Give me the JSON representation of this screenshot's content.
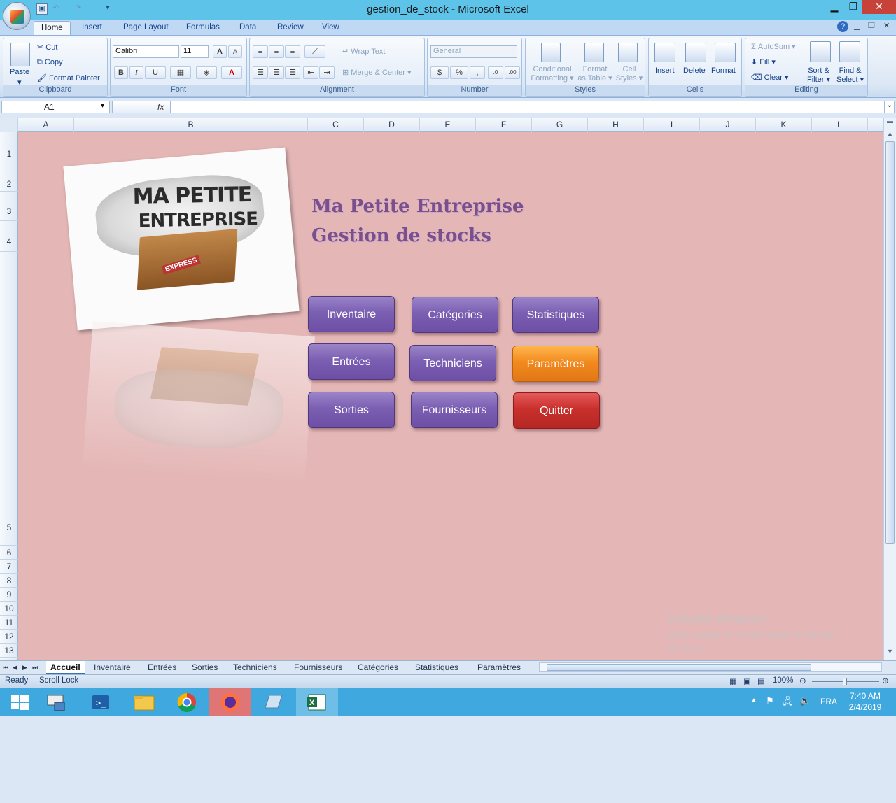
{
  "window": {
    "title": "gestion_de_stock - Microsoft Excel",
    "minimize": "▁",
    "restore": "❐",
    "close": "✕"
  },
  "ribbon_tabs": [
    "Home",
    "Insert",
    "Page Layout",
    "Formulas",
    "Data",
    "Review",
    "View"
  ],
  "clipboard": {
    "paste": "Paste",
    "cut": "Cut",
    "copy": "Copy",
    "format_painter": "Format Painter",
    "label": "Clipboard"
  },
  "font": {
    "name": "Calibri",
    "size": "11",
    "label": "Font",
    "bold": "B",
    "italic": "I",
    "underline": "U",
    "grow": "A",
    "shrink": "A"
  },
  "alignment": {
    "wrap_text": "Wrap Text",
    "merge_center": "Merge & Center",
    "label": "Alignment"
  },
  "number": {
    "format": "General",
    "label": "Number",
    "currency": "$",
    "percent": "%",
    "comma": ",",
    "inc_decimal": ".0→.00",
    "dec_decimal": ".00→.0"
  },
  "styles": {
    "conditional": "Conditional",
    "conditional2": "Formatting",
    "format_table": "Format",
    "format_table2": "as Table",
    "cell_styles": "Cell",
    "cell_styles2": "Styles",
    "label": "Styles"
  },
  "cells": {
    "insert": "Insert",
    "delete": "Delete",
    "format": "Format",
    "label": "Cells"
  },
  "editing": {
    "autosum": "AutoSum",
    "fill": "Fill",
    "clear": "Clear",
    "sort_filter": "Sort &",
    "sort_filter2": "Filter",
    "find_select": "Find &",
    "find_select2": "Select",
    "label": "Editing"
  },
  "formula_bar": {
    "name_box": "A1",
    "fx": "fx",
    "formula": ""
  },
  "columns": [
    "A",
    "B",
    "C",
    "D",
    "E",
    "F",
    "G",
    "H",
    "I",
    "J",
    "K",
    "L"
  ],
  "rows": [
    "1",
    "2",
    "3",
    "4",
    "5",
    "6",
    "7",
    "8",
    "9",
    "10",
    "11",
    "12",
    "13"
  ],
  "logo": {
    "line1": "MA PETITE",
    "line2": "ENTREPRISE",
    "stamp": "EXPRESS"
  },
  "headline": {
    "line1": "Ma Petite Entreprise",
    "line2": "Gestion de stocks"
  },
  "buttons": {
    "inventaire": "Inventaire",
    "categories": "Catégories",
    "statistiques": "Statistiques",
    "entrees": "Entrées",
    "techniciens": "Techniciens",
    "parametres": "Paramètres",
    "sorties": "Sorties",
    "fournisseurs": "Fournisseurs",
    "quitter": "Quitter"
  },
  "activate": {
    "title": "Activate Windows",
    "line1": "Go to System in Control Panel to activate",
    "line2": "Windows."
  },
  "sheet_tabs": [
    "Accueil",
    "Inventaire",
    "Entrées",
    "Sorties",
    "Techniciens",
    "Fournisseurs",
    "Catégories",
    "Statistiques",
    "Paramètres"
  ],
  "status": {
    "ready": "Ready",
    "scroll_lock": "Scroll Lock",
    "zoom": "100%"
  },
  "tray": {
    "lang": "FRA",
    "time": "7:40 AM",
    "date": "2/4/2019"
  },
  "colors": {
    "sheet_bg": "#e4b7b6",
    "button_purple": "#7b5fb2",
    "button_orange": "#f28a1e",
    "button_red": "#c9302c",
    "headline": "#7a4f8d"
  }
}
